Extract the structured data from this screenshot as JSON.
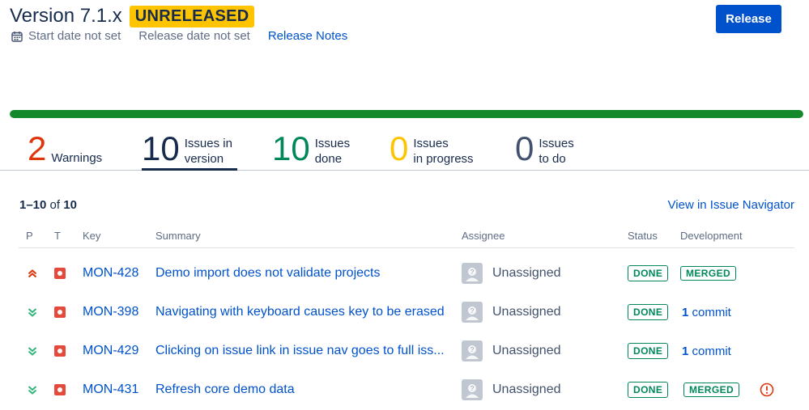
{
  "header": {
    "title": "Version 7.1.x",
    "status_lozenge": "UNRELEASED",
    "start_date": "Start date not set",
    "release_date": "Release date not set",
    "release_notes_link": "Release Notes",
    "release_button": "Release"
  },
  "progress": {
    "done_fraction": 1.0,
    "color": "#14892c"
  },
  "stats": [
    {
      "number": "2",
      "label_line1": "Warnings",
      "label_line2": "",
      "color": "#de350b"
    },
    {
      "number": "10",
      "label_line1": "Issues in",
      "label_line2": "version",
      "color": "#172b4d",
      "active": true
    },
    {
      "number": "10",
      "label_line1": "Issues",
      "label_line2": "done",
      "color": "#00875a"
    },
    {
      "number": "0",
      "label_line1": "Issues",
      "label_line2": "in progress",
      "color": "#ffc400"
    },
    {
      "number": "0",
      "label_line1": "Issues",
      "label_line2": "to do",
      "color": "#42526e"
    }
  ],
  "table": {
    "range": "1–10",
    "of_word": "of",
    "total": "10",
    "view_link": "View in Issue Navigator",
    "columns": {
      "p": "P",
      "t": "T",
      "key": "Key",
      "summary": "Summary",
      "assignee": "Assignee",
      "status": "Status",
      "development": "Development"
    },
    "rows": [
      {
        "priority": "highest-priority-icon",
        "type": "bug-icon",
        "key": "MON-428",
        "summary": "Demo import does not validate projects",
        "assignee": "Unassigned",
        "status": "DONE",
        "development": {
          "kind": "badge",
          "text": "MERGED"
        },
        "warning": false
      },
      {
        "priority": "lowest-priority-icon",
        "type": "bug-icon",
        "key": "MON-398",
        "summary": "Navigating with keyboard causes key to be erased",
        "assignee": "Unassigned",
        "status": "DONE",
        "development": {
          "kind": "commit",
          "count": "1",
          "text": "commit"
        },
        "warning": false
      },
      {
        "priority": "lowest-priority-icon",
        "type": "bug-icon",
        "key": "MON-429",
        "summary": "Clicking on issue link in issue nav goes to full iss...",
        "assignee": "Unassigned",
        "status": "DONE",
        "development": {
          "kind": "commit",
          "count": "1",
          "text": "commit"
        },
        "warning": false
      },
      {
        "priority": "lowest-priority-icon",
        "type": "bug-icon",
        "key": "MON-431",
        "summary": "Refresh core demo data",
        "assignee": "Unassigned",
        "status": "DONE",
        "development": {
          "kind": "badge",
          "text": "MERGED"
        },
        "warning": true
      }
    ]
  }
}
